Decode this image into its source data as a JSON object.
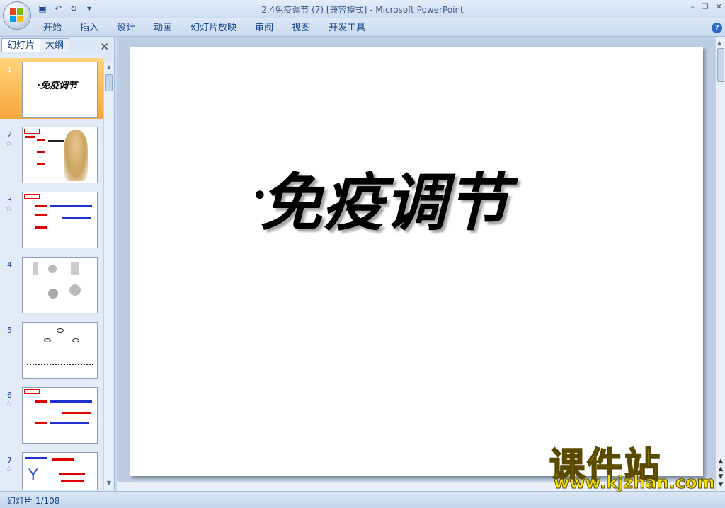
{
  "window": {
    "title": "2.4免疫调节 (7) [兼容模式] - Microsoft PowerPoint",
    "minimize": "–",
    "restore": "❐",
    "close": "✕"
  },
  "quick_access": [
    "save-icon",
    "undo-icon",
    "redo-icon",
    "customize-icon"
  ],
  "ribbon": {
    "tabs": [
      "开始",
      "插入",
      "设计",
      "动画",
      "幻灯片放映",
      "审阅",
      "视图",
      "开发工具"
    ],
    "help": "?"
  },
  "left_pane": {
    "tabs": [
      "幻灯片",
      "大纲"
    ],
    "close": "✕",
    "thumbnails": [
      {
        "num": "1",
        "title": "·免疫调节",
        "selected": true
      },
      {
        "num": "2",
        "star": "☆"
      },
      {
        "num": "3",
        "star": "☆"
      },
      {
        "num": "4"
      },
      {
        "num": "5"
      },
      {
        "num": "6",
        "star": "☆"
      },
      {
        "num": "7",
        "star": "☆"
      }
    ]
  },
  "slide": {
    "bullet": "•",
    "title": "免疫调节"
  },
  "status": {
    "slide_info": "幻灯片 1/108"
  },
  "watermark": {
    "main": "课件站",
    "url": "www.kjzhan.com"
  },
  "colors": {
    "accent": "#15428b",
    "selected_thumb": "#f6a63e"
  }
}
